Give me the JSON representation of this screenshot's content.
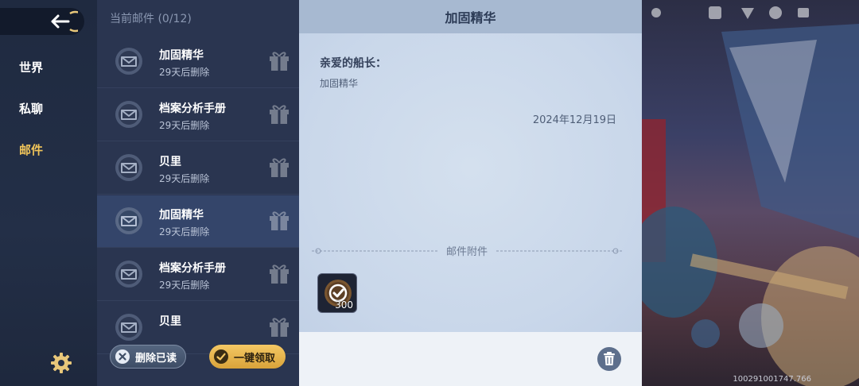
{
  "nav": {
    "items": [
      {
        "label": "世界",
        "active": false
      },
      {
        "label": "私聊",
        "active": false
      },
      {
        "label": "邮件",
        "active": true
      }
    ]
  },
  "mail_list": {
    "header": "当前邮件 (0/12)",
    "items": [
      {
        "title": "加固精华",
        "sub": "29天后删除",
        "selected": false
      },
      {
        "title": "档案分析手册",
        "sub": "29天后删除",
        "selected": false
      },
      {
        "title": "贝里",
        "sub": "29天后删除",
        "selected": false
      },
      {
        "title": "加固精华",
        "sub": "29天后删除",
        "selected": true
      },
      {
        "title": "档案分析手册",
        "sub": "29天后删除",
        "selected": false
      },
      {
        "title": "贝里",
        "sub": "",
        "selected": false
      }
    ],
    "delete_read_label": "删除已读",
    "claim_all_label": "一键领取"
  },
  "detail": {
    "title": "加固精华",
    "greeting": "亲爱的船长：",
    "content": "加固精华",
    "date": "2024年12月19日",
    "attachments_label": "邮件附件",
    "attachments": [
      {
        "icon": "reinforce-essence-icon",
        "quantity": "300"
      }
    ]
  },
  "build_id": "100291001747.766",
  "colors": {
    "accent": "#f0c45a",
    "panel": "#2a3550",
    "detail_bg": "#dce6f2"
  }
}
